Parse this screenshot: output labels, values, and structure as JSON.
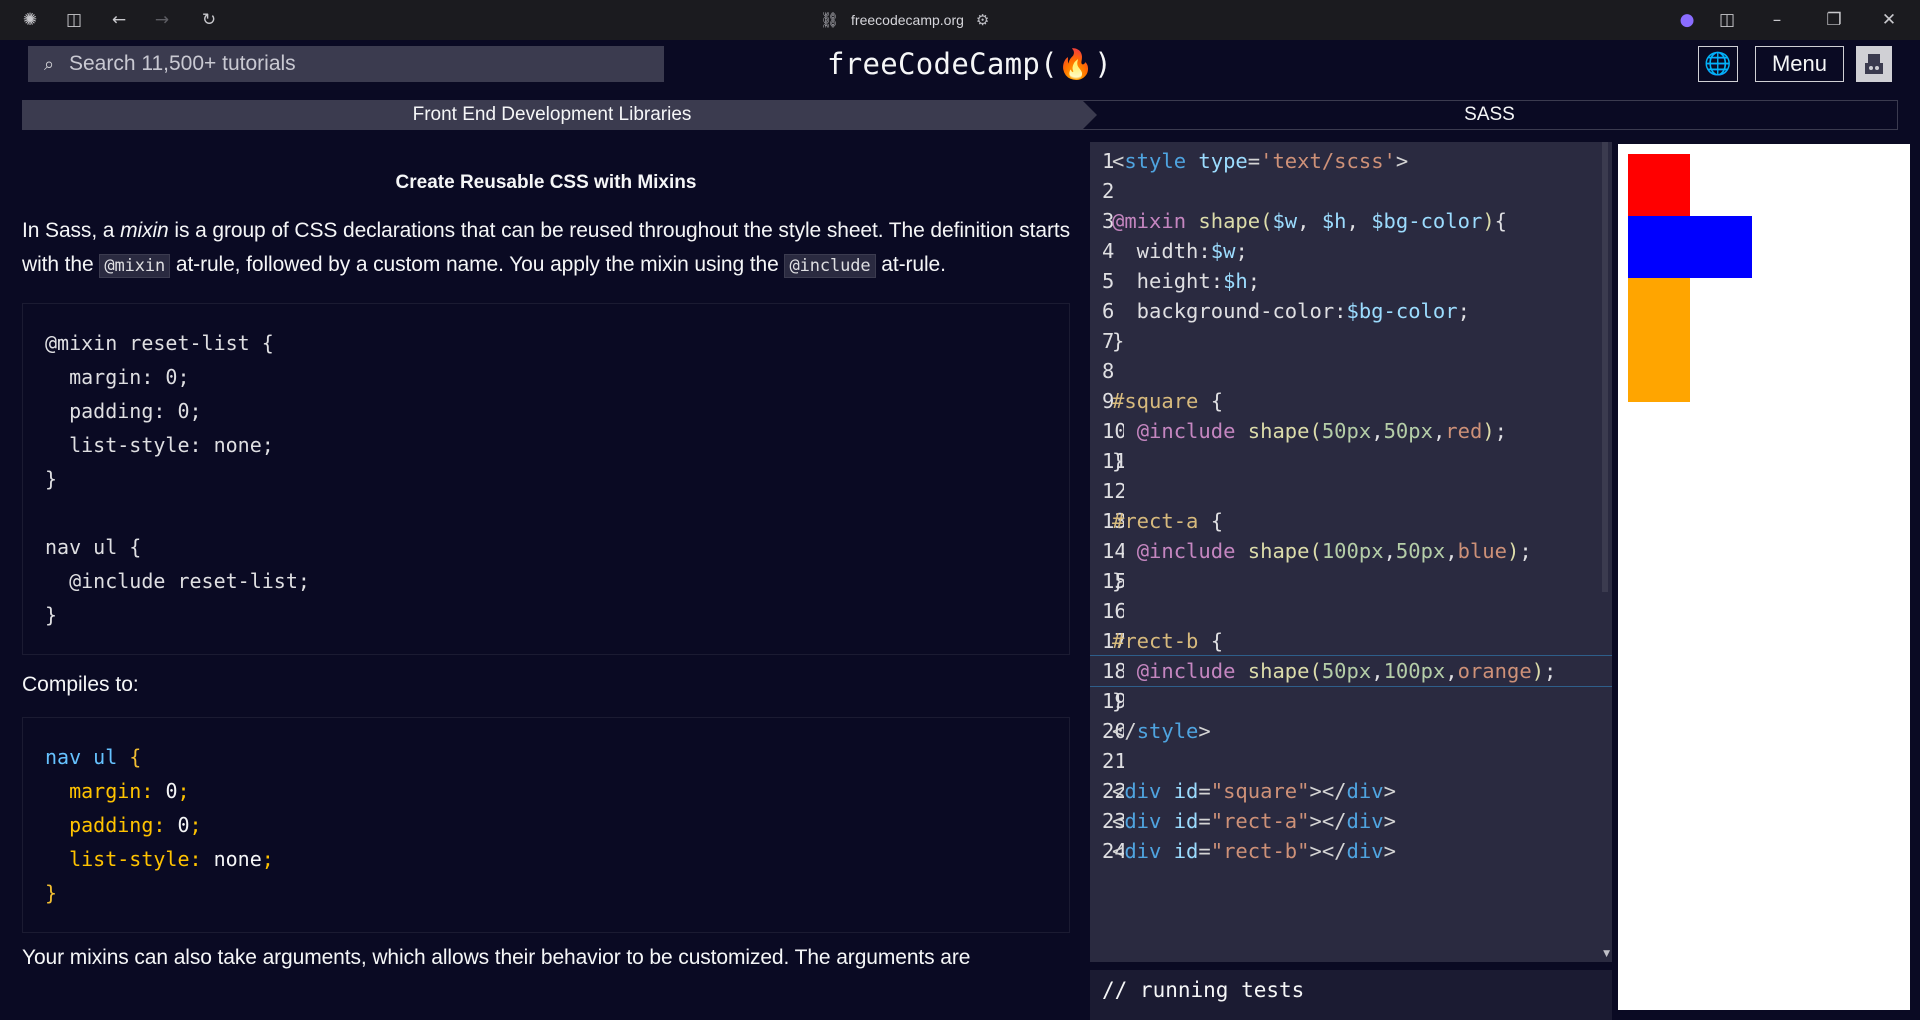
{
  "browser": {
    "url": "freecodecamp.org",
    "icons": [
      "app-logo-icon",
      "sidebar-icon",
      "back-arrow-icon",
      "forward-arrow-icon",
      "reload-icon",
      "link-icon",
      "settings-sliders-icon",
      "flame-icon",
      "split-view-icon",
      "minimize-icon",
      "restore-icon",
      "close-icon"
    ]
  },
  "nav": {
    "search_placeholder": "Search 11,500+ tutorials",
    "logo": "freeCodeCamp(🔥)",
    "menu_label": "Menu"
  },
  "breadcrumb": {
    "superblock": "Front End Development Libraries",
    "block": "SASS"
  },
  "lesson": {
    "title": "Create Reusable CSS with Mixins",
    "intro_1": "In Sass, a ",
    "intro_em": "mixin",
    "intro_2": " is a group of CSS declarations that can be reused throughout the style sheet. The definition starts with the ",
    "intro_code1": "@mixin",
    "intro_3": " at-rule, followed by a custom name. You apply the mixin using the ",
    "intro_code2": "@include",
    "intro_4": " at-rule.",
    "example_code": "@mixin reset-list {\n  margin: 0;\n  padding: 0;\n  list-style: none;\n}\n\nnav ul {\n  @include reset-list;\n}",
    "compiles_label": "Compiles to:",
    "compiled": {
      "selector": "nav ul",
      "open": " {",
      "decls": [
        {
          "prop": "margin",
          "val": "0"
        },
        {
          "prop": "padding",
          "val": "0"
        },
        {
          "prop": "list-style",
          "val": "none"
        }
      ],
      "close": "}"
    },
    "next_para": "Your mixins can also take arguments, which allows their behavior to be customized. The arguments are"
  },
  "editor": {
    "lines": [
      {
        "n": "1",
        "html": "<span class='t-pun'>&lt;</span><span class='t-tag'>style</span> <span class='t-attr'>type</span><span class='t-pun'>=</span><span class='t-str'>'text/scss'</span><span class='t-pun'>&gt;</span>"
      },
      {
        "n": "2",
        "html": ""
      },
      {
        "n": "3",
        "html": "<span class='t-mix'>@mixin</span> <span class='t-fn'>shape(</span><span class='t-var'>$w</span>, <span class='t-var'>$h</span>, <span class='t-var'>$bg-color</span><span class='t-fn'>)</span>{"
      },
      {
        "n": "4",
        "html": "  width:<span class='t-var'>$w</span>;"
      },
      {
        "n": "5",
        "html": "  height:<span class='t-var'>$h</span>;"
      },
      {
        "n": "6",
        "html": "  background-color:<span class='t-var'>$bg-color</span>;"
      },
      {
        "n": "7",
        "html": "}"
      },
      {
        "n": "8",
        "html": ""
      },
      {
        "n": "9",
        "html": "<span class='t-sel'>#square</span> {"
      },
      {
        "n": "10",
        "html": "  <span class='t-mix'>@include</span> <span class='t-fn'>shape(</span><span class='t-num'>50px</span>,<span class='t-num'>50px</span>,<span class='t-str'>red</span><span class='t-fn'>)</span>;"
      },
      {
        "n": "11",
        "html": "}"
      },
      {
        "n": "12",
        "html": ""
      },
      {
        "n": "13",
        "html": "<span class='t-sel'>#rect-a</span> {"
      },
      {
        "n": "14",
        "html": "  <span class='t-mix'>@include</span> <span class='t-fn'>shape(</span><span class='t-num'>100px</span>,<span class='t-num'>50px</span>,<span class='t-str'>blue</span><span class='t-fn'>)</span>;"
      },
      {
        "n": "15",
        "html": "}"
      },
      {
        "n": "16",
        "html": ""
      },
      {
        "n": "17",
        "html": "<span class='t-sel'>#rect-b</span> {"
      },
      {
        "n": "18",
        "html": "  <span class='t-mix'>@include</span> <span class='t-fn'>shape(</span><span class='t-num'>50px</span>,<span class='t-num'>100px</span>,<span class='t-str'>orange</span><span class='t-fn'>)</span>;",
        "active": true
      },
      {
        "n": "19",
        "html": "}"
      },
      {
        "n": "20",
        "html": "<span class='t-pun'>&lt;/</span><span class='t-tag'>style</span><span class='t-pun'>&gt;</span>"
      },
      {
        "n": "21",
        "html": ""
      },
      {
        "n": "22",
        "html": "<span class='t-pun'>&lt;</span><span class='t-tag'>div</span> <span class='t-attr'>id</span><span class='t-pun'>=</span><span class='t-str'>\"square\"</span><span class='t-pun'>&gt;&lt;/</span><span class='t-tag'>div</span><span class='t-pun'>&gt;</span>"
      },
      {
        "n": "23",
        "html": "<span class='t-pun'>&lt;</span><span class='t-tag'>div</span> <span class='t-attr'>id</span><span class='t-pun'>=</span><span class='t-str'>\"rect-a\"</span><span class='t-pun'>&gt;&lt;/</span><span class='t-tag'>div</span><span class='t-pun'>&gt;</span>"
      },
      {
        "n": "24",
        "html": "<span class='t-pun'>&lt;</span><span class='t-tag'>div</span> <span class='t-attr'>id</span><span class='t-pun'>=</span><span class='t-str'>\"rect-b\"</span><span class='t-pun'>&gt;&lt;/</span><span class='t-tag'>div</span><span class='t-pun'>&gt;</span>"
      }
    ]
  },
  "console": {
    "text": "// running tests"
  },
  "preview": {
    "shapes": [
      {
        "id": "square",
        "color": "#ff0000"
      },
      {
        "id": "rect-a",
        "color": "#0000ff"
      },
      {
        "id": "rect-b",
        "color": "#ffa500"
      }
    ]
  },
  "colors": {
    "background": "#0a0a23",
    "panel": "#3b3b4f",
    "editor": "#2a2a40",
    "accent_yellow": "#f1be32",
    "accent_blue": "#66c2ff"
  }
}
